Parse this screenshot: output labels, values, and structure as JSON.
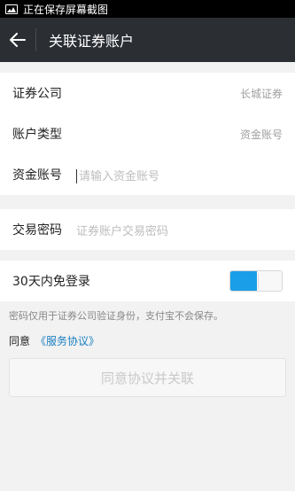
{
  "statusbar": {
    "text": "正在保存屏幕截图"
  },
  "header": {
    "title": "关联证券账户"
  },
  "form": {
    "broker_label": "证券公司",
    "broker_value": "长城证券",
    "account_type_label": "账户类型",
    "account_type_value": "资金账号",
    "fund_account_label": "资金账号",
    "fund_account_placeholder": "请输入资金账号",
    "password_label": "交易密码",
    "password_placeholder": "证券账户交易密码",
    "remember_label": "30天内免登录"
  },
  "remember_enabled": true,
  "note": "密码仅用于证券公司验证身份，支付宝不会保存。",
  "agreement": {
    "prefix": "同意",
    "link": "《服务协议》"
  },
  "submit_label": "同意协议并关联",
  "colors": {
    "header_bg": "#2b2e33",
    "toggle_on": "#1a9ee8",
    "link": "#1a7fc1"
  }
}
